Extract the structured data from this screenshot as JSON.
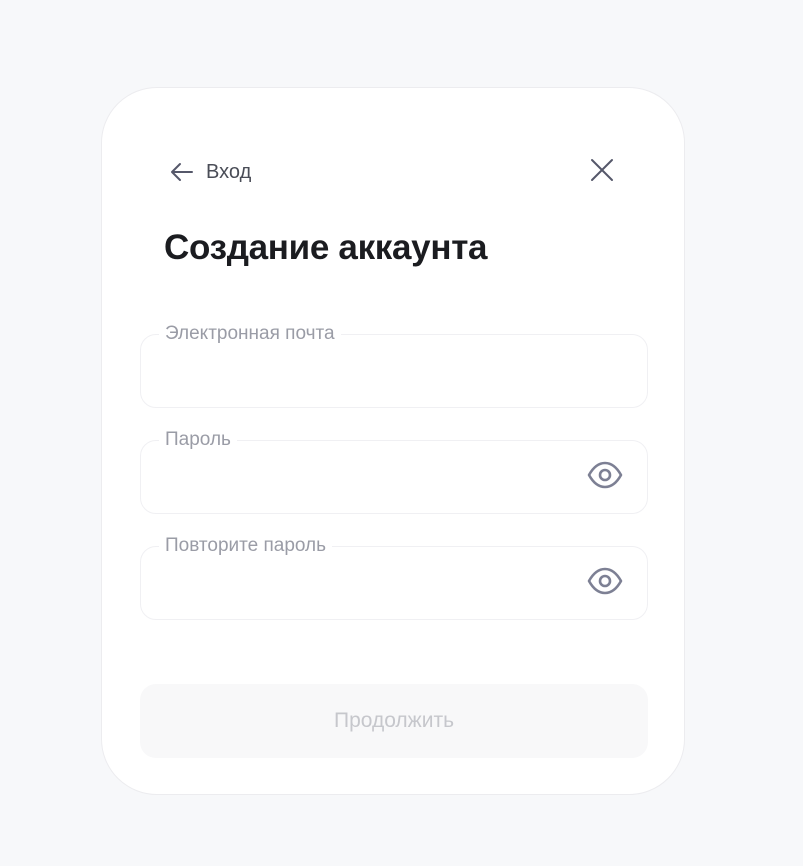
{
  "header": {
    "back_label": "Вход",
    "back_icon": "arrow-left-icon",
    "close_icon": "close-icon"
  },
  "title": "Создание аккаунта",
  "form": {
    "email": {
      "label": "Электронная почта",
      "value": ""
    },
    "password": {
      "label": "Пароль",
      "value": "",
      "toggle_icon": "eye-icon"
    },
    "repeat_password": {
      "label": "Повторите пароль",
      "value": "",
      "toggle_icon": "eye-icon"
    },
    "continue_label": "Продолжить",
    "continue_disabled": true
  },
  "colors": {
    "page_background": "#f7f8fa",
    "card_background": "#ffffff",
    "title": "#1b1c20",
    "label": "#9a9ca6",
    "icon": "#7d8094",
    "button_disabled_bg": "#f8f8f9",
    "button_disabled_text": "#c6c7cc"
  }
}
